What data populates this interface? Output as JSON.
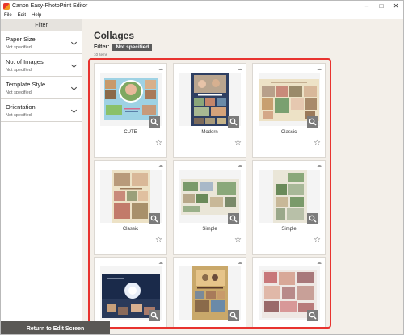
{
  "window": {
    "title": "Canon Easy-PhotoPrint Editor"
  },
  "menu": {
    "file": "File",
    "edit": "Edit",
    "help": "Help"
  },
  "filter_panel": {
    "header": "Filter",
    "items": [
      {
        "label": "Paper Size",
        "value": "Not specified"
      },
      {
        "label": "No. of Images",
        "value": "Not specified"
      },
      {
        "label": "Template Style",
        "value": "Not specified"
      },
      {
        "label": "Orientation",
        "value": "Not specified"
      }
    ]
  },
  "main": {
    "title": "Collages",
    "filter_label": "Filter:",
    "filter_tag": "Not specified",
    "count": "10 items"
  },
  "templates": [
    {
      "name": "CUTE"
    },
    {
      "name": "Modern"
    },
    {
      "name": "Classic"
    },
    {
      "name": "Classic"
    },
    {
      "name": "Simple"
    },
    {
      "name": "Simple"
    },
    {
      "name": ""
    },
    {
      "name": ""
    },
    {
      "name": ""
    }
  ],
  "footer": {
    "return_button": "Return to Edit Screen"
  },
  "colors": {
    "accent_border": "#e8332f",
    "footer_button": "#5a5855"
  }
}
